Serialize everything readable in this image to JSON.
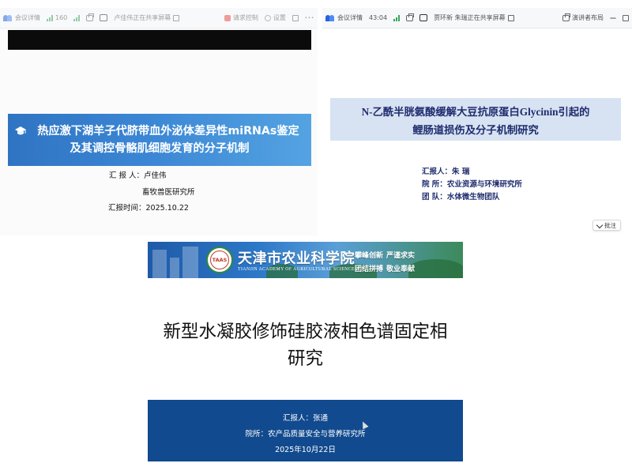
{
  "window1": {
    "toolbar": {
      "meeting_label": "会议详情",
      "signal_text": "160",
      "share_status": "卢佳伟正在共享屏幕",
      "request_control": "请求控制",
      "settings": "设置"
    },
    "slide": {
      "title_line1": "热应激下湖羊子代脐带血外泌体差异性miRNAs鉴定",
      "title_line2": "及其调控骨骼肌细胞发育的分子机制",
      "reporter_label": "汇  报 人：",
      "reporter_name": "卢佳伟",
      "institute": "畜牧兽医研究所",
      "date_label": "汇报时间：",
      "date": "2025.10.22"
    }
  },
  "window2": {
    "toolbar": {
      "meeting_label": "会议详情",
      "timer": "43:04",
      "share_status": "贾环新 朱瑞正在共享屏幕",
      "layout_label": "演讲者布局"
    },
    "slide": {
      "title_line1": "N-乙酰半胱氨酸缓解大豆抗原蛋白Glycinin引起的",
      "title_line2": "鲤肠道损伤及分子机制研究",
      "reporter_label": "汇报人：",
      "reporter_name": "朱  瑞",
      "institute_label": "院    所：",
      "institute": "农业资源与环境研究所",
      "team_label": "团    队：",
      "team": "水体微生物团队"
    },
    "annotate_button": "批注"
  },
  "slide3": {
    "academy_name": "天津市农业科学院",
    "academy_en": "TIANJIN ACADEMY OF AGRICULTURAL SCIENCES",
    "seal_text": "TAAS",
    "motto": [
      "攀峰创新",
      "严谨求实",
      "团结拼搏",
      "敬业奉献"
    ],
    "title_line1": "新型水凝胶修饰硅胶液相色谱固定相",
    "title_line2": "研究",
    "reporter": "汇报人：张通",
    "institute": "院所：农产品质量安全与营养研究所",
    "date": "2025年10月22日"
  },
  "colors": {
    "banner1": "#3b86d4",
    "banner2_bg": "#d7e3f2",
    "banner2_text": "#1f2c6e",
    "footer3": "#114a8e"
  }
}
